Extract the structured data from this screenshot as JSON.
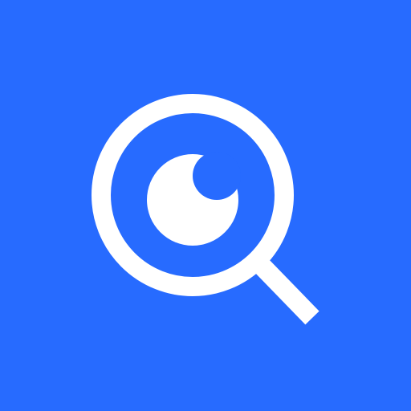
{
  "icon": {
    "name": "magnifier-eye-icon",
    "colors": {
      "background": "#276BFF",
      "foreground": "#FFFFFF"
    }
  }
}
